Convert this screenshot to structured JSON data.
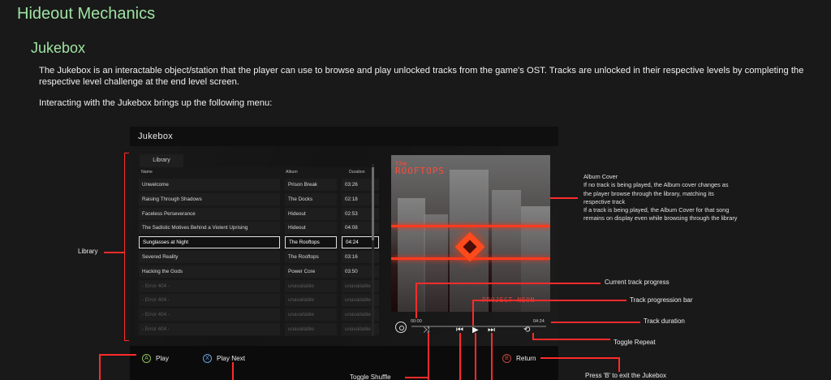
{
  "page": {
    "heading": "Hideout Mechanics",
    "subheading": "Jukebox",
    "paragraph1": "The Jukebox is an interactable object/station that the player can use to browse and play unlocked tracks from the game's OST. Tracks are unlocked in their respective levels by completing the respective level challenge at the end level screen.",
    "paragraph2": "Interacting with the Jukebox brings up the following menu:"
  },
  "jukebox": {
    "title": "Jukebox",
    "library_tab": "Library",
    "columns": {
      "name": "Name",
      "album": "Album",
      "duration": "Duration"
    },
    "tracks": [
      {
        "name": "Unwelcome",
        "album": "Prison Break",
        "duration": "03:26"
      },
      {
        "name": "Raising Through Shadows",
        "album": "The Docks",
        "duration": "02:18"
      },
      {
        "name": "Faceless Perseverance",
        "album": "Hideout",
        "duration": "02:53"
      },
      {
        "name": "The Sadistic Motives Behind a Violent Uprising",
        "album": "Hideout",
        "duration": "04:08"
      },
      {
        "name": "Sunglasses at Night",
        "album": "The Rooftops",
        "duration": "04:24"
      },
      {
        "name": "Severed Reality",
        "album": "The Rooftops",
        "duration": "03:16"
      },
      {
        "name": "Hacking the Gods",
        "album": "Power Core",
        "duration": "03:50"
      },
      {
        "name": "- Error 404 -",
        "album": "unavailable",
        "duration": "unavailable"
      },
      {
        "name": "- Error 404 -",
        "album": "unavailable",
        "duration": "unavailable"
      },
      {
        "name": "- Error 404 -",
        "album": "unavailable",
        "duration": "unavailable"
      },
      {
        "name": "- Error 404 -",
        "album": "unavailable",
        "duration": "unavailable"
      }
    ],
    "selected_index": 4,
    "cover": {
      "line1": "the",
      "line2": "ROOFTOPS",
      "footer": "PROJECT NEON"
    },
    "player": {
      "current_time": "00:00",
      "total_time": "04:24",
      "progress": 0.0
    },
    "buttons": {
      "play_glyph": "A",
      "play": "Play",
      "play_next_glyph": "X",
      "play_next": "Play Next",
      "return_glyph": "B",
      "return": "Return"
    }
  },
  "annotations": {
    "library": "Library",
    "album_cover": [
      "Album Cover",
      "If no track is being played, the Album cover changes as",
      "the player browse through the library, matching its",
      "respective track",
      "If a track is being played, the Album Cover for that song",
      "remains on display even while browsing through the library"
    ],
    "current_progress": "Current track progress",
    "progress_bar": "Track progression bar",
    "duration": "Track duration",
    "toggle_repeat": "Toggle Repeat",
    "toggle_shuffle": "Toggle Shuffle",
    "exit": "Press 'B' to exit the Jukebox"
  },
  "colors": {
    "heading": "#9fe3a3",
    "annotation_line": "#ff2b2b",
    "accent": "#ff4a1c"
  }
}
